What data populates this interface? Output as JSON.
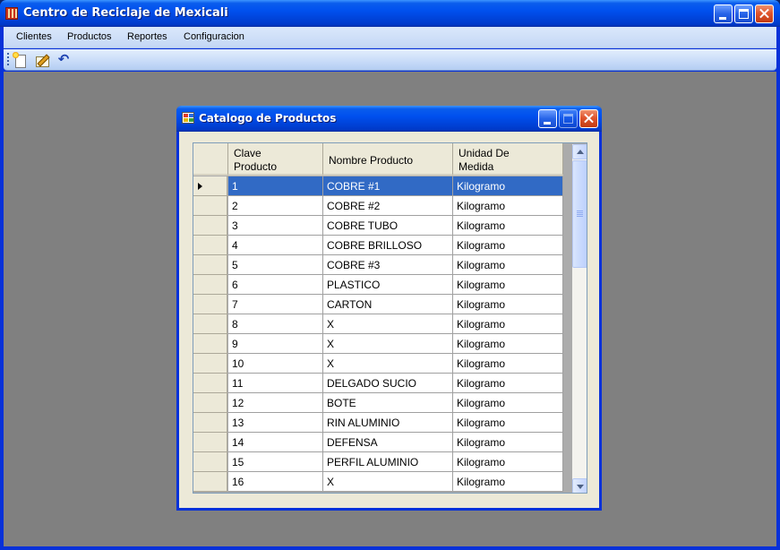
{
  "app": {
    "title": "Centro de Reciclaje de Mexicali"
  },
  "menu": [
    "Clientes",
    "Productos",
    "Reportes",
    "Configuracion"
  ],
  "toolbar": {
    "undo_glyph": "↶"
  },
  "child": {
    "title": "Catalogo de Productos"
  },
  "grid": {
    "columns": [
      "Clave\nProducto",
      "Nombre Producto",
      "Unidad De\nMedida"
    ],
    "rows": [
      {
        "clave": "1",
        "nombre": "COBRE #1",
        "unidad": "Kilogramo"
      },
      {
        "clave": "2",
        "nombre": "COBRE #2",
        "unidad": "Kilogramo"
      },
      {
        "clave": "3",
        "nombre": "COBRE TUBO",
        "unidad": "Kilogramo"
      },
      {
        "clave": "4",
        "nombre": "COBRE BRILLOSO",
        "unidad": "Kilogramo"
      },
      {
        "clave": "5",
        "nombre": "COBRE #3",
        "unidad": "Kilogramo"
      },
      {
        "clave": "6",
        "nombre": "PLASTICO",
        "unidad": "Kilogramo"
      },
      {
        "clave": "7",
        "nombre": "CARTON",
        "unidad": "Kilogramo"
      },
      {
        "clave": "8",
        "nombre": "X",
        "unidad": "Kilogramo"
      },
      {
        "clave": "9",
        "nombre": "X",
        "unidad": "Kilogramo"
      },
      {
        "clave": "10",
        "nombre": "X",
        "unidad": "Kilogramo"
      },
      {
        "clave": "11",
        "nombre": "DELGADO SUCIO",
        "unidad": "Kilogramo"
      },
      {
        "clave": "12",
        "nombre": "BOTE",
        "unidad": "Kilogramo"
      },
      {
        "clave": "13",
        "nombre": "RIN ALUMINIO",
        "unidad": "Kilogramo"
      },
      {
        "clave": "14",
        "nombre": "DEFENSA",
        "unidad": "Kilogramo"
      },
      {
        "clave": "15",
        "nombre": "PERFIL ALUMINIO",
        "unidad": "Kilogramo"
      },
      {
        "clave": "16",
        "nombre": "X",
        "unidad": "Kilogramo"
      }
    ],
    "selected_index": 0
  }
}
